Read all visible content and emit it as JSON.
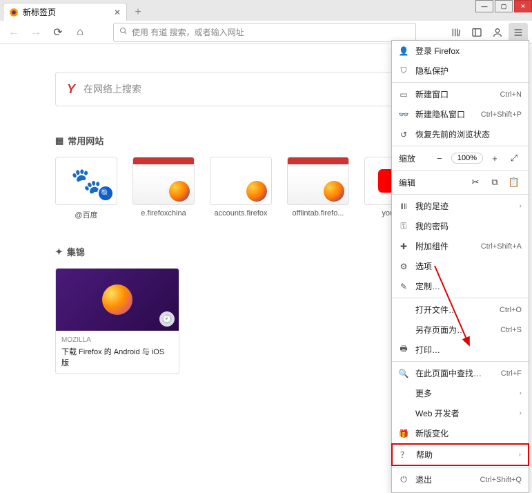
{
  "tab": {
    "title": "新标签页"
  },
  "addressbar": {
    "placeholder": "使用 有道 搜索，或者输入网址"
  },
  "hero_search": {
    "logo": "Y",
    "placeholder": "在网络上搜索"
  },
  "sections": {
    "topsites": "常用网站",
    "highlights": "集锦"
  },
  "tiles": [
    {
      "label": "@百度"
    },
    {
      "label": "e.firefoxchina"
    },
    {
      "label": "accounts.firefox"
    },
    {
      "label": "offlintab.firefo..."
    },
    {
      "label": "youtube"
    }
  ],
  "highlight": {
    "source": "MOZILLA",
    "title": "下载 Firefox 的 Android 与 iOS 版"
  },
  "menu": {
    "signin": "登录 Firefox",
    "privacy": "隐私保护",
    "new_window": "新建窗口",
    "new_private": "新建隐私窗口",
    "restore": "恢复先前的浏览状态",
    "zoom_label": "缩放",
    "zoom_value": "100%",
    "edit_label": "编辑",
    "library": "我的足迹",
    "passwords": "我的密码",
    "addons": "附加组件",
    "options": "选项",
    "customize": "定制…",
    "open_file": "打开文件…",
    "save_as": "另存页面为…",
    "print": "打印…",
    "find": "在此页面中查找…",
    "more": "更多",
    "webdev": "Web 开发者",
    "whatsnew": "新版变化",
    "help": "帮助",
    "exit": "退出",
    "sc_new_window": "Ctrl+N",
    "sc_new_private": "Ctrl+Shift+P",
    "sc_addons": "Ctrl+Shift+A",
    "sc_open_file": "Ctrl+O",
    "sc_save_as": "Ctrl+S",
    "sc_find": "Ctrl+F",
    "sc_exit": "Ctrl+Shift+Q"
  }
}
